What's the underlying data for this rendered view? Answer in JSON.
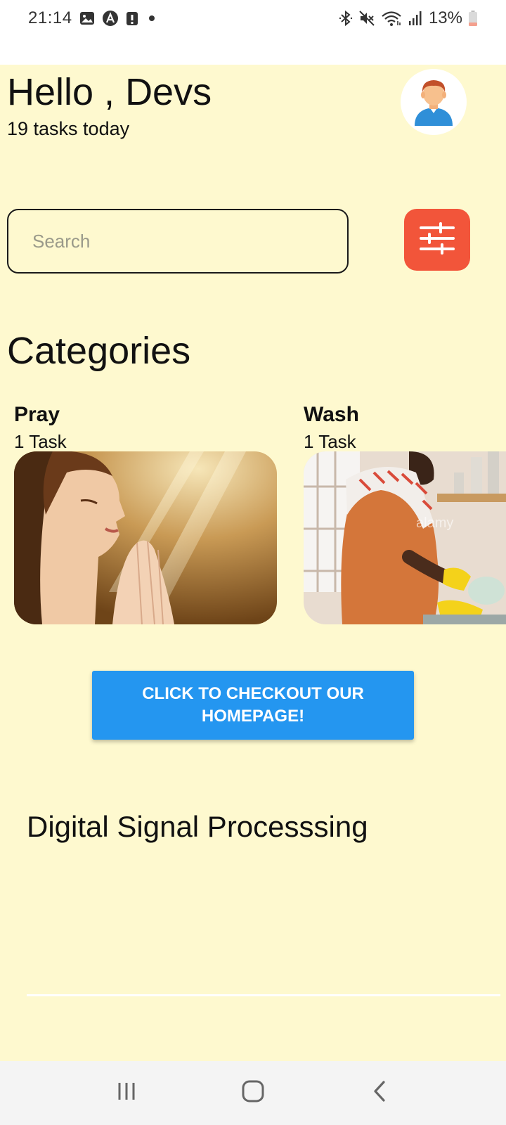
{
  "status_bar": {
    "time": "21:14",
    "battery_percent": "13%",
    "left_icons": [
      "image-icon",
      "a-circle-icon",
      "alert-icon",
      "dot-icon"
    ],
    "right_icons": [
      "bluetooth-icon",
      "mute-icon",
      "wifi-icon",
      "signal-icon",
      "battery-icon"
    ]
  },
  "header": {
    "greeting": "Hello , Devs",
    "task_count": "19 tasks today",
    "avatar_icon": "user-avatar-icon"
  },
  "search": {
    "placeholder": "Search",
    "filter_icon": "sliders-icon",
    "filter_color": "#f2553a"
  },
  "categories": {
    "title": "Categories",
    "items": [
      {
        "name": "Pray",
        "count": "1 Task",
        "image": "praying-woman-photo"
      },
      {
        "name": "Wash",
        "count": "1 Task",
        "image": "man-washing-dishes-photo"
      }
    ]
  },
  "cta": {
    "label": "CLICK TO CHECKOUT OUR HOMEPAGE!",
    "color": "#2496f0"
  },
  "subject": {
    "title": "Digital Signal Processsing"
  },
  "nav_bar": {
    "items": [
      "recent-apps-icon",
      "home-icon",
      "back-icon"
    ]
  },
  "theme": {
    "background": "#fef9cf"
  }
}
